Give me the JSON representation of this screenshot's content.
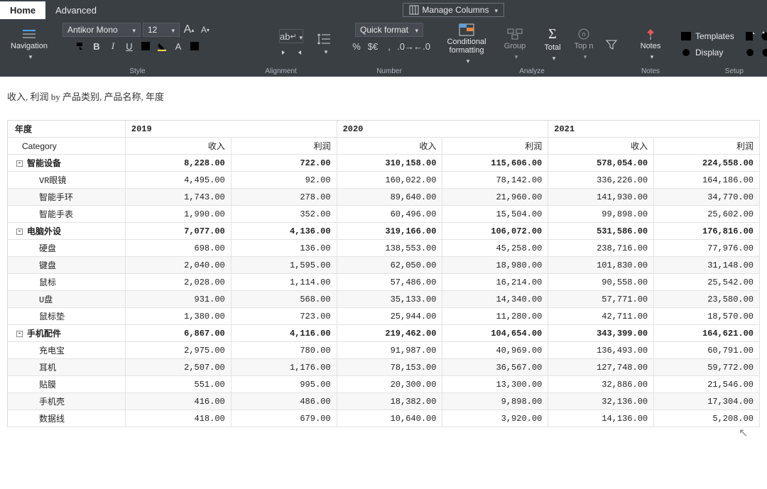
{
  "tabs": {
    "home": "Home",
    "advanced": "Advanced"
  },
  "manageColumns": "Manage Columns",
  "ribbon": {
    "navigation": "Navigation",
    "font": "Antikor Mono",
    "fontSize": "12",
    "quickFormat": "Quick format",
    "conditional": "Conditional formatting",
    "group": "Group",
    "total": "Total",
    "topn": "Top n",
    "notes": "Notes",
    "templates": "Templates",
    "display": "Display",
    "grpStyle": "Style",
    "grpAlign": "Alignment",
    "grpNumber": "Number",
    "grpAnalyze": "Analyze",
    "grpNotes": "Notes",
    "grpSetup": "Setup"
  },
  "title": "收入, 利润 by 产品类别, 产品名称, 年度",
  "headers": {
    "yearLabel": "年度",
    "categoryLabel": "Category",
    "years": [
      "2019",
      "2020",
      "2021"
    ],
    "measures": [
      "收入",
      "利润"
    ]
  },
  "rows": [
    {
      "type": "subtotal",
      "label": "智能设备",
      "v": [
        "8,228.00",
        "722.00",
        "310,158.00",
        "115,606.00",
        "578,054.00",
        "224,558.00"
      ]
    },
    {
      "type": "detail",
      "label": "VR眼镜",
      "v": [
        "4,495.00",
        "92.00",
        "160,022.00",
        "78,142.00",
        "336,226.00",
        "164,186.00"
      ]
    },
    {
      "type": "detail",
      "label": "智能手环",
      "v": [
        "1,743.00",
        "278.00",
        "89,640.00",
        "21,960.00",
        "141,930.00",
        "34,770.00"
      ]
    },
    {
      "type": "detail",
      "label": "智能手表",
      "v": [
        "1,990.00",
        "352.00",
        "60,496.00",
        "15,504.00",
        "99,898.00",
        "25,602.00"
      ]
    },
    {
      "type": "subtotal",
      "label": "电脑外设",
      "v": [
        "7,077.00",
        "4,136.00",
        "319,166.00",
        "106,072.00",
        "531,586.00",
        "176,816.00"
      ]
    },
    {
      "type": "detail",
      "label": "硬盘",
      "v": [
        "698.00",
        "136.00",
        "138,553.00",
        "45,258.00",
        "238,716.00",
        "77,976.00"
      ]
    },
    {
      "type": "detail",
      "label": "键盘",
      "v": [
        "2,040.00",
        "1,595.00",
        "62,050.00",
        "18,980.00",
        "101,830.00",
        "31,148.00"
      ]
    },
    {
      "type": "detail",
      "label": "鼠标",
      "v": [
        "2,028.00",
        "1,114.00",
        "57,486.00",
        "16,214.00",
        "90,558.00",
        "25,542.00"
      ]
    },
    {
      "type": "detail",
      "label": "U盘",
      "v": [
        "931.00",
        "568.00",
        "35,133.00",
        "14,340.00",
        "57,771.00",
        "23,580.00"
      ]
    },
    {
      "type": "detail",
      "label": "鼠标垫",
      "v": [
        "1,380.00",
        "723.00",
        "25,944.00",
        "11,280.00",
        "42,711.00",
        "18,570.00"
      ]
    },
    {
      "type": "subtotal",
      "label": "手机配件",
      "v": [
        "6,867.00",
        "4,116.00",
        "219,462.00",
        "104,654.00",
        "343,399.00",
        "164,621.00"
      ]
    },
    {
      "type": "detail",
      "label": "充电宝",
      "v": [
        "2,975.00",
        "780.00",
        "91,987.00",
        "40,969.00",
        "136,493.00",
        "60,791.00"
      ]
    },
    {
      "type": "detail",
      "label": "耳机",
      "v": [
        "2,507.00",
        "1,176.00",
        "78,153.00",
        "36,567.00",
        "127,748.00",
        "59,772.00"
      ]
    },
    {
      "type": "detail",
      "label": "贴膜",
      "v": [
        "551.00",
        "995.00",
        "20,300.00",
        "13,300.00",
        "32,886.00",
        "21,546.00"
      ]
    },
    {
      "type": "detail",
      "label": "手机壳",
      "v": [
        "416.00",
        "486.00",
        "18,382.00",
        "9,898.00",
        "32,136.00",
        "17,304.00"
      ]
    },
    {
      "type": "detail",
      "label": "数据线",
      "v": [
        "418.00",
        "679.00",
        "10,640.00",
        "3,920.00",
        "14,136.00",
        "5,208.00"
      ]
    }
  ]
}
